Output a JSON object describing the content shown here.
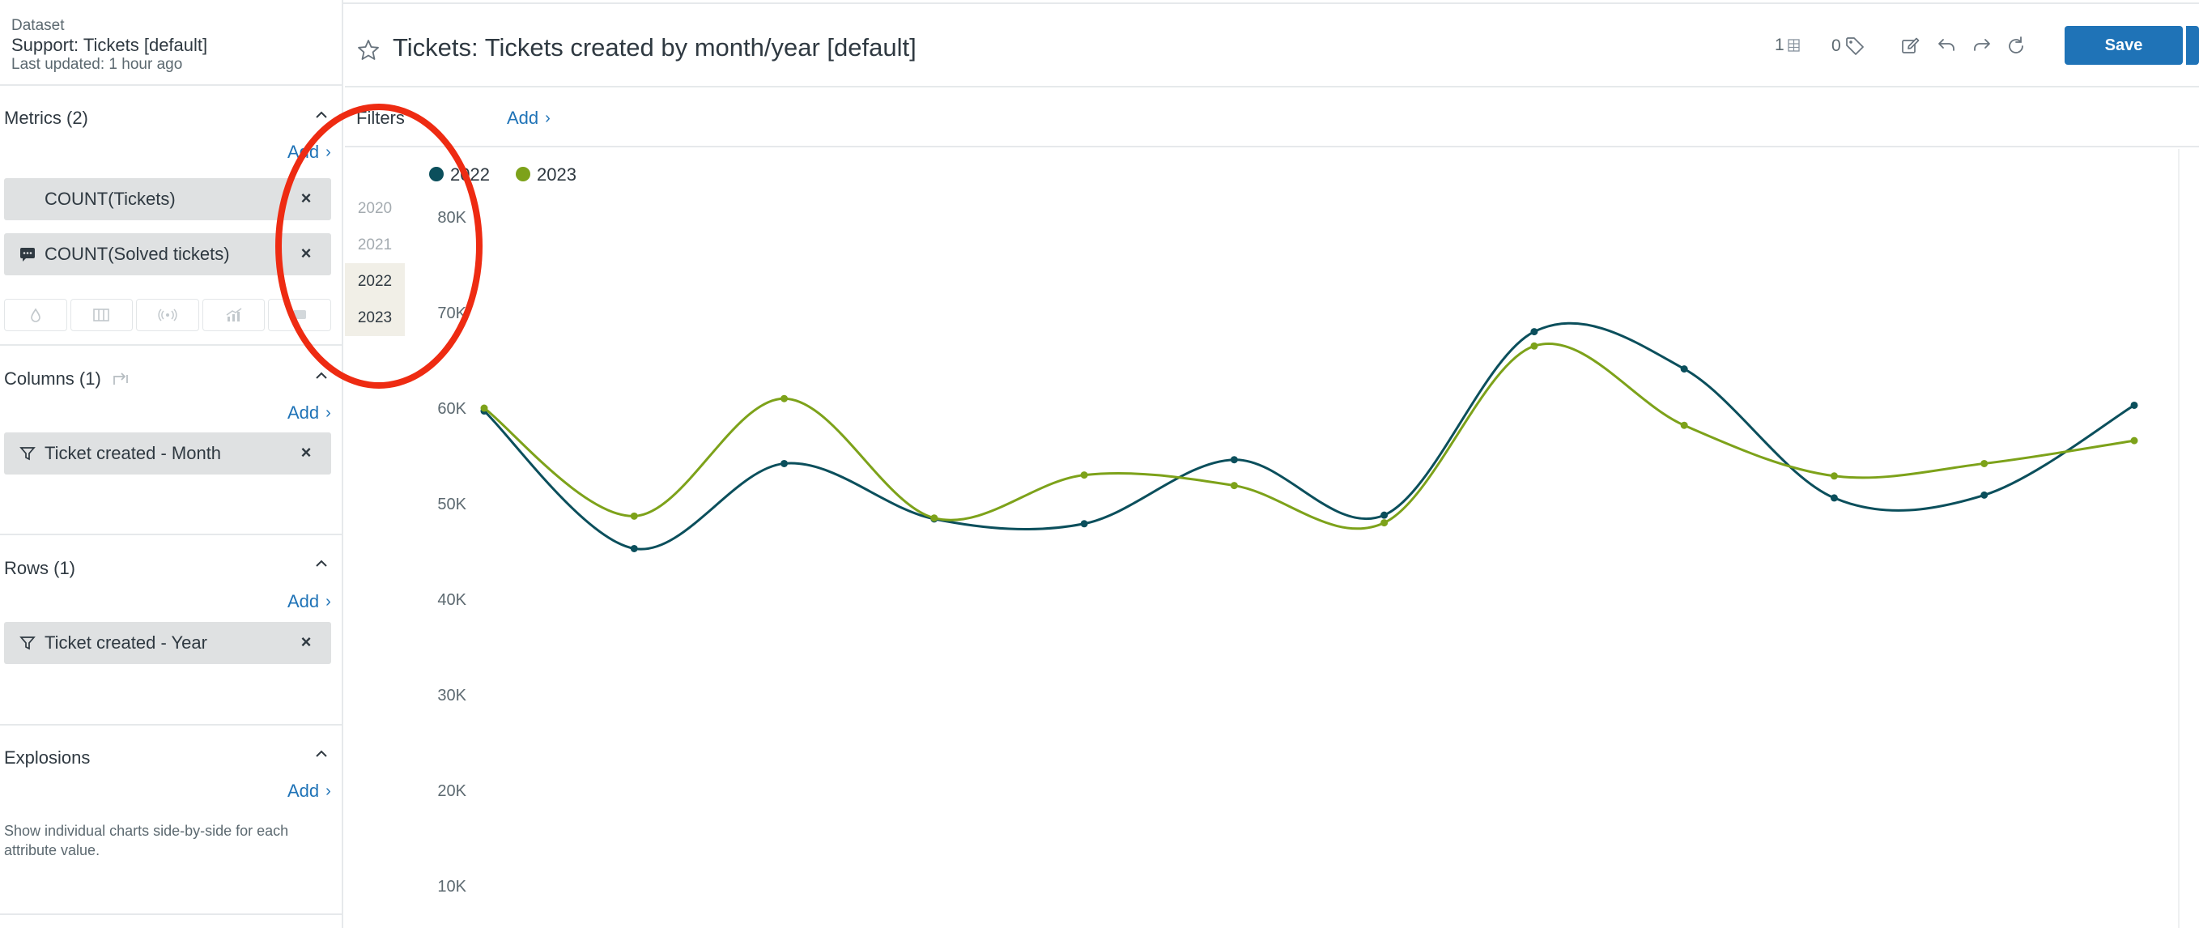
{
  "dataset": {
    "label": "Dataset",
    "name": "Support: Tickets [default]",
    "updated": "Last updated: 1 hour ago"
  },
  "metrics": {
    "title": "Metrics (2)",
    "add_label": "Add",
    "items": [
      "COUNT(Tickets)",
      "COUNT(Solved tickets)"
    ]
  },
  "columns": {
    "title": "Columns (1)",
    "add_label": "Add",
    "items": [
      "Ticket created - Month"
    ]
  },
  "rows": {
    "title": "Rows (1)",
    "add_label": "Add",
    "items": [
      "Ticket created - Year"
    ]
  },
  "explosions": {
    "title": "Explosions",
    "add_label": "Add",
    "description": "Show individual charts side-by-side for each attribute value."
  },
  "header": {
    "title": "Tickets: Tickets created by month/year [default]",
    "attachments_count": "1",
    "tags_count": "0",
    "save_label": "Save"
  },
  "filters": {
    "label": "Filters",
    "add_label": "Add"
  },
  "year_picker": {
    "options": [
      "2020",
      "2021",
      "2022",
      "2023"
    ],
    "selected": [
      "2022",
      "2023"
    ]
  },
  "colors": {
    "primary": "#1f73b7",
    "series_2022": "#0b4f5c",
    "series_2023": "#7da21a",
    "annotation": "#ee2b12"
  },
  "chart_data": {
    "type": "line",
    "title": "",
    "xlabel": "",
    "ylabel": "",
    "x": [
      1,
      2,
      3,
      4,
      5,
      6,
      7,
      8,
      9,
      10,
      11,
      12
    ],
    "ylim": [
      0,
      80000
    ],
    "yticks": [
      "80K",
      "70K",
      "60K",
      "50K",
      "40K",
      "30K",
      "20K",
      "10K"
    ],
    "grid": false,
    "legend": "top-left",
    "smooth": true,
    "series": [
      {
        "name": "2022",
        "color": "#0b4f5c",
        "values": [
          59700,
          45300,
          54200,
          48400,
          47900,
          54600,
          48800,
          68000,
          64100,
          50600,
          50900,
          60300
        ]
      },
      {
        "name": "2023",
        "color": "#7da21a",
        "values": [
          60000,
          48700,
          61000,
          48500,
          53000,
          51900,
          48000,
          66500,
          58200,
          52900,
          54200,
          56600
        ]
      }
    ]
  }
}
